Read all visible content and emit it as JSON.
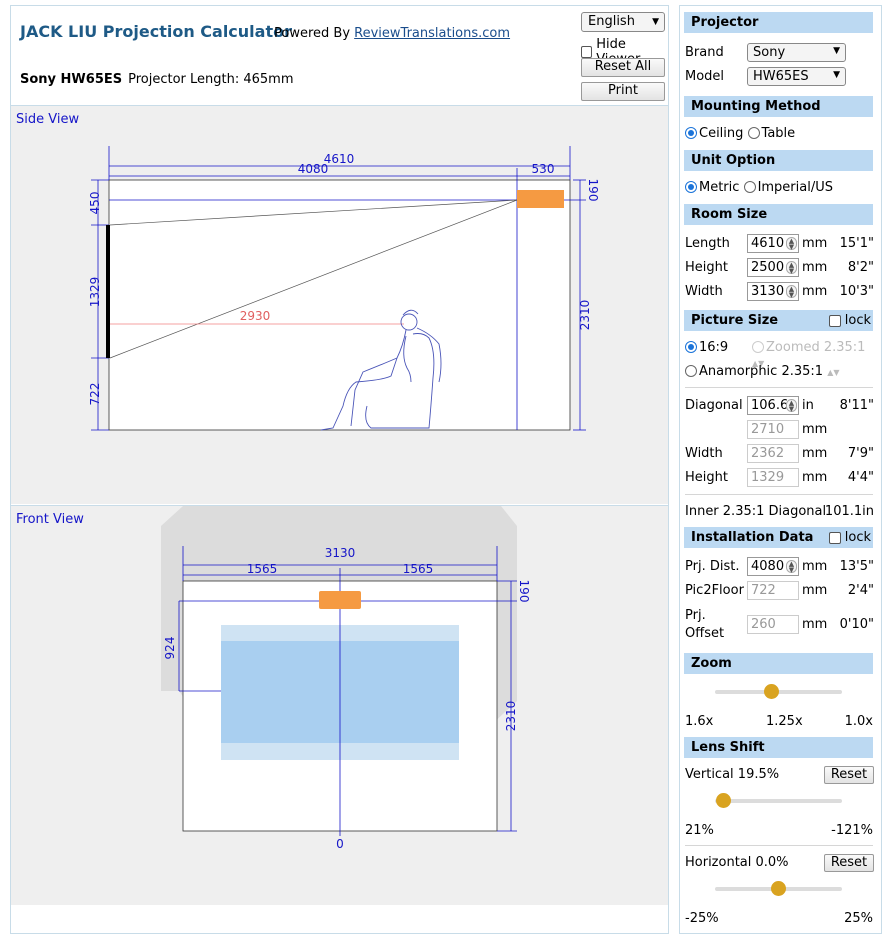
{
  "header": {
    "title": "JACK LIU Projection Calculator",
    "powered_prefix": "Powered By",
    "powered_link": "ReviewTranslations.com",
    "device": "Sony HW65ES",
    "projector_length": "Projector Length: 465mm",
    "language": "English",
    "hide_viewer": "Hide Viewer",
    "reset_all": "Reset All",
    "print": "Print"
  },
  "side_view": {
    "title": "Side View",
    "dim_total": "4610",
    "dim_throw": "4080",
    "dim_proj": "530",
    "dim_top": "450",
    "dim_screen": "1329",
    "dim_bottom": "722",
    "dim_proj_drop": "190",
    "dim_lens_height": "2310",
    "dim_seat": "2930"
  },
  "front_view": {
    "title": "Front View",
    "dim_width": "3130",
    "dim_left": "1565",
    "dim_right": "1565",
    "dim_top": "924",
    "dim_drop": "190",
    "dim_height": "2310",
    "dim_center": "0"
  },
  "sidebar": {
    "projector": {
      "header": "Projector",
      "brand_label": "Brand",
      "brand": "Sony",
      "model_label": "Model",
      "model": "HW65ES"
    },
    "mounting": {
      "header": "Mounting Method",
      "ceiling": "Ceiling",
      "table": "Table"
    },
    "units": {
      "header": "Unit Option",
      "metric": "Metric",
      "imperial": "Imperial/US"
    },
    "room": {
      "header": "Room Size",
      "length_label": "Length",
      "length": "4610",
      "length_unit": "mm",
      "length_alt": "15'1\"",
      "height_label": "Height",
      "height": "2500",
      "height_unit": "mm",
      "height_alt": "8'2\"",
      "width_label": "Width",
      "width": "3130",
      "width_unit": "mm",
      "width_alt": "10'3\""
    },
    "picture": {
      "header": "Picture Size",
      "lock": "lock",
      "ratio_169": "16:9",
      "ratio_zoomed": "Zoomed 2.35:1",
      "ratio_anamorphic": "Anamorphic 2.35:1",
      "diagonal_label": "Diagonal",
      "diagonal": "106.6",
      "diagonal_unit": "in",
      "diagonal_alt": "8'11\"",
      "diagonal_mm": "2710",
      "diagonal_mm_unit": "mm",
      "width_label": "Width",
      "width": "2362",
      "width_unit": "mm",
      "width_alt": "7'9\"",
      "height_label": "Height",
      "height": "1329",
      "height_unit": "mm",
      "height_alt": "4'4\"",
      "inner_label": "Inner 2.35:1 Diagonal",
      "inner_value": "101.1in"
    },
    "install": {
      "header": "Installation Data",
      "lock": "lock",
      "prj_dist_label": "Prj. Dist.",
      "prj_dist": "4080",
      "prj_dist_unit": "mm",
      "prj_dist_alt": "13'5\"",
      "pic2floor_label": "Pic2Floor",
      "pic2floor": "722",
      "pic2floor_unit": "mm",
      "pic2floor_alt": "2'4\"",
      "offset_label_1": "Prj.",
      "offset_label_2": "Offset",
      "offset": "260",
      "offset_unit": "mm",
      "offset_alt": "0'10\""
    },
    "zoom": {
      "header": "Zoom",
      "min": "1.6x",
      "mid": "1.25x",
      "max": "1.0x",
      "level": 0.44
    },
    "lens_shift": {
      "header": "Lens Shift",
      "vertical_label": "Vertical 19.5%",
      "vertical_reset": "Reset",
      "vertical_min": "21%",
      "vertical_max": "-121%",
      "vertical_level": 0.01,
      "horizontal_label": "Horizontal 0.0%",
      "horizontal_reset": "Reset",
      "horizontal_min": "-25%",
      "horizontal_max": "25%",
      "horizontal_level": 0.5
    }
  }
}
